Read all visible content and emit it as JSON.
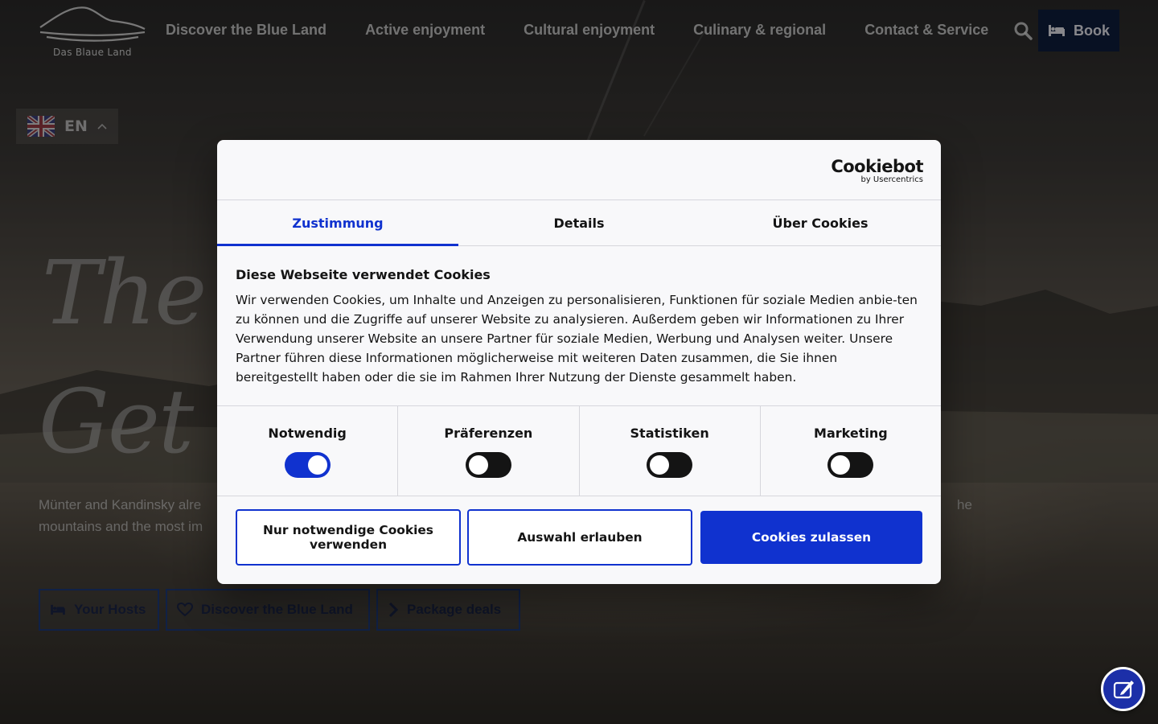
{
  "header": {
    "logo_text": "Das Blaue Land",
    "nav": [
      {
        "label": "Discover the Blue Land"
      },
      {
        "label": "Active enjoyment"
      },
      {
        "label": "Cultural enjoyment"
      },
      {
        "label": "Culinary & regional"
      },
      {
        "label": "Contact & Service"
      }
    ],
    "book_label": "Book"
  },
  "language": {
    "code": "EN"
  },
  "hero": {
    "script_line1": "The Bl",
    "script_line2": "Get ins",
    "desc_line1": "Münter and Kandinsky alre",
    "desc_line2": "mountains and the most im",
    "desc_right": "he",
    "ctas": [
      {
        "label": "Your Hosts",
        "icon": "bed-icon"
      },
      {
        "label": "Discover the Blue Land",
        "icon": "heart-icon"
      },
      {
        "label": "Package deals",
        "icon": "chevron-right-icon"
      }
    ]
  },
  "cookie_dialog": {
    "brand": "Cookiebot",
    "brand_sub": "by Usercentrics",
    "tabs": [
      {
        "label": "Zustimmung",
        "active": true
      },
      {
        "label": "Details",
        "active": false
      },
      {
        "label": "Über Cookies",
        "active": false
      }
    ],
    "heading": "Diese Webseite verwendet Cookies",
    "body": "Wir verwenden Cookies, um Inhalte und Anzeigen zu personalisieren, Funktionen für soziale Medien anbie-ten zu können und die Zugriffe auf unserer Website zu analysieren. Außerdem geben wir Informationen zu Ihrer Verwendung unserer Website an unsere Partner für soziale Medien, Werbung und Analysen weiter. Unsere Partner führen diese Informationen möglicherweise mit weiteren Daten zusammen, die Sie ihnen bereitgestellt haben oder die sie im Rahmen Ihrer Nutzung der Dienste gesammelt haben.",
    "toggles": [
      {
        "label": "Notwendig",
        "on": true
      },
      {
        "label": "Präferenzen",
        "on": false
      },
      {
        "label": "Statistiken",
        "on": false
      },
      {
        "label": "Marketing",
        "on": false
      }
    ],
    "buttons": {
      "necessary_only": "Nur notwendige Cookies verwenden",
      "allow_selection": "Auswahl erlauben",
      "allow_all": "Cookies zulassen"
    }
  },
  "colors": {
    "accent": "#1032cf",
    "nav_dark": "#0f1e3d"
  }
}
